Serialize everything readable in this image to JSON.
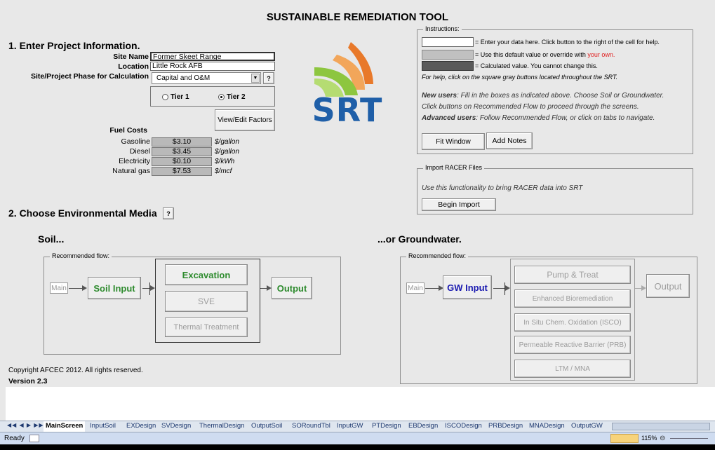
{
  "app": {
    "title": "SUSTAINABLE REMEDIATION TOOL",
    "copyright": "Copyright AFCEC 2012.  All rights reserved.",
    "version": "Version 2.3"
  },
  "section1": {
    "heading": "1.  Enter Project Information.",
    "site_name_label": "Site Name",
    "site_name_value": "Former Skeet Range",
    "location_label": "Location",
    "location_value": "Little Rock AFB",
    "phase_label": "Site/Project Phase for Calculation",
    "phase_value": "Capital and O&M",
    "help_label": "?",
    "tier1_label": "Tier 1",
    "tier2_label": "Tier 2",
    "tier_selected": "Tier 2",
    "view_edit_label": "View/Edit Factors"
  },
  "fuel": {
    "heading": "Fuel Costs",
    "rows": [
      {
        "label": "Gasoline",
        "value": "$3.10",
        "unit": "$/gallon"
      },
      {
        "label": "Diesel",
        "value": "$3.45",
        "unit": "$/gallon"
      },
      {
        "label": "Electricity",
        "value": "$0.10",
        "unit": "$/kWh"
      },
      {
        "label": "Natural gas",
        "value": "$7.53",
        "unit": "$/mcf"
      }
    ]
  },
  "logo": {
    "text": "SRT",
    "colors": {
      "orange": "#e8792a",
      "green": "#8dc63f",
      "blue": "#1f5fa8"
    }
  },
  "instructions": {
    "legend": "Instructions:",
    "line1": "= Enter your data here.  Click button to the right of the cell for help.",
    "line2_prefix": "= Use this default value or override with ",
    "line2_red": "your own.",
    "line3": "= Calculated value.  You cannot change this.",
    "help_line": "For help, click on the square gray buttons located throughout the SRT.",
    "new_users_label": "New users",
    "new_users_text": ":   Fill in the boxes as indicated above.  Choose Soil or Groundwater.",
    "new_users_text2": "Click buttons on Recommended Flow to proceed through the screens.",
    "advanced_label": "Advanced users",
    "advanced_text": ":  Follow Recommended Flow, or click on tabs to navigate.",
    "fit_window_label": "Fit Window",
    "add_notes_label": "Add Notes"
  },
  "racer": {
    "legend": "Import RACER Files",
    "text": "Use this functionality to bring RACER data into SRT",
    "begin_import_label": "Begin Import"
  },
  "section2": {
    "heading": "2.  Choose Environmental Media",
    "help_label": "?",
    "soil_heading": "Soil...",
    "gw_heading": "...or Groundwater."
  },
  "soil_flow": {
    "legend": "Recommended flow:",
    "main_label": "Main",
    "input_label": "Soil Input",
    "options": [
      "Excavation",
      "SVE",
      "Thermal Treatment"
    ],
    "output_label": "Output"
  },
  "gw_flow": {
    "legend": "Recommended flow:",
    "main_label": "Main",
    "input_label": "GW Input",
    "options": [
      "Pump & Treat",
      "Enhanced Bioremediation",
      "In Situ Chem. Oxidation (ISCO)",
      "Permeable Reactive Barrier (PRB)",
      "LTM / MNA"
    ],
    "output_label": "Output"
  },
  "tabs": [
    "MainScreen",
    "InputSoil",
    "EXDesign",
    "SVDesign",
    "ThermalDesign",
    "OutputSoil",
    "SORoundTbl",
    "InputGW",
    "PTDesign",
    "EBDesign",
    "ISCODesign",
    "PRBDesign",
    "MNADesign",
    "OutputGW"
  ],
  "status": {
    "ready": "Ready",
    "zoom": "115%"
  }
}
